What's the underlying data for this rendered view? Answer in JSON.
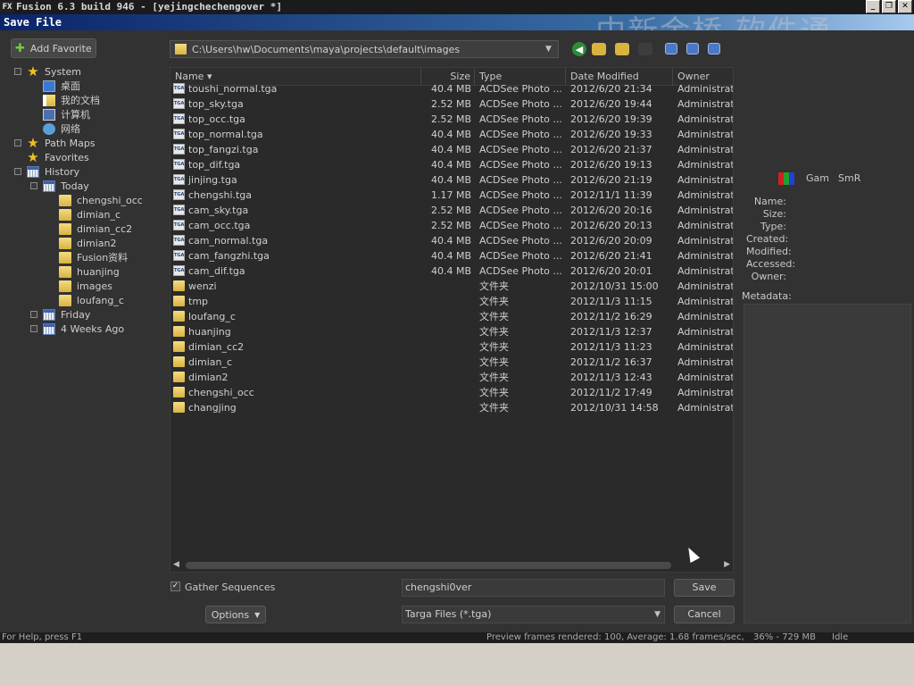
{
  "app": {
    "title": "Fusion 6.3 build 946 - [yejingchechengover *]",
    "logo": "FX",
    "window_buttons": [
      "_",
      "❐",
      "✕"
    ]
  },
  "watermark": "中新金桥 软件通",
  "dialog": {
    "title": "Save File"
  },
  "sidebar": {
    "add_favorite": "Add Favorite",
    "tree": [
      {
        "label": "System",
        "icon": "star-icon",
        "level": 0,
        "expander": true
      },
      {
        "label": "桌面",
        "icon": "desktop-icon",
        "level": 1,
        "expander": false
      },
      {
        "label": "我的文档",
        "icon": "my-documents-icon",
        "level": 1,
        "expander": false
      },
      {
        "label": "计算机",
        "icon": "computer-icon",
        "level": 1,
        "expander": false
      },
      {
        "label": "网络",
        "icon": "network-icon",
        "level": 1,
        "expander": false
      },
      {
        "label": "Path Maps",
        "icon": "star-icon",
        "level": 0,
        "expander": true
      },
      {
        "label": "Favorites",
        "icon": "star-icon",
        "level": 0,
        "expander": false
      },
      {
        "label": "History",
        "icon": "calendar-icon",
        "level": 0,
        "expander": true
      },
      {
        "label": "Today",
        "icon": "calendar-icon",
        "level": 1,
        "expander": true
      },
      {
        "label": "chengshi_occ",
        "icon": "folder-icon",
        "level": 2,
        "expander": false
      },
      {
        "label": "dimian_c",
        "icon": "folder-icon",
        "level": 2,
        "expander": false
      },
      {
        "label": "dimian_cc2",
        "icon": "folder-icon",
        "level": 2,
        "expander": false
      },
      {
        "label": "dimian2",
        "icon": "folder-icon",
        "level": 2,
        "expander": false
      },
      {
        "label": "Fusion资料",
        "icon": "folder-icon",
        "level": 2,
        "expander": false
      },
      {
        "label": "huanjing",
        "icon": "folder-icon",
        "level": 2,
        "expander": false
      },
      {
        "label": "images",
        "icon": "folder-icon",
        "level": 2,
        "expander": false
      },
      {
        "label": "loufang_c",
        "icon": "folder-icon",
        "level": 2,
        "expander": false
      },
      {
        "label": "Friday",
        "icon": "calendar-icon",
        "level": 1,
        "expander": true
      },
      {
        "label": "4 Weeks Ago",
        "icon": "calendar-icon",
        "level": 1,
        "expander": true
      }
    ]
  },
  "path": {
    "value": "C:\\Users\\hw\\Documents\\maya\\projects\\default\\images"
  },
  "list": {
    "columns": [
      "Name ▾",
      "Size",
      "Type",
      "Date Modified",
      "Owner"
    ],
    "rows": [
      {
        "name": "toushi_normal.tga",
        "size": "40.4 MB",
        "type": "ACDSee Photo ...",
        "date": "2012/6/20 21:34",
        "owner": "Administrator",
        "kind": "tga"
      },
      {
        "name": "top_sky.tga",
        "size": "2.52 MB",
        "type": "ACDSee Photo ...",
        "date": "2012/6/20 19:44",
        "owner": "Administrator",
        "kind": "tga"
      },
      {
        "name": "top_occ.tga",
        "size": "2.52 MB",
        "type": "ACDSee Photo ...",
        "date": "2012/6/20 19:39",
        "owner": "Administrator",
        "kind": "tga"
      },
      {
        "name": "top_normal.tga",
        "size": "40.4 MB",
        "type": "ACDSee Photo ...",
        "date": "2012/6/20 19:33",
        "owner": "Administrator",
        "kind": "tga"
      },
      {
        "name": "top_fangzi.tga",
        "size": "40.4 MB",
        "type": "ACDSee Photo ...",
        "date": "2012/6/20 21:37",
        "owner": "Administrator",
        "kind": "tga"
      },
      {
        "name": "top_dif.tga",
        "size": "40.4 MB",
        "type": "ACDSee Photo ...",
        "date": "2012/6/20 19:13",
        "owner": "Administrator",
        "kind": "tga"
      },
      {
        "name": "jinjing.tga",
        "size": "40.4 MB",
        "type": "ACDSee Photo ...",
        "date": "2012/6/20 21:19",
        "owner": "Administrator",
        "kind": "tga"
      },
      {
        "name": "chengshi.tga",
        "size": "1.17 MB",
        "type": "ACDSee Photo ...",
        "date": "2012/11/1 11:39",
        "owner": "Administrator",
        "kind": "tga"
      },
      {
        "name": "cam_sky.tga",
        "size": "2.52 MB",
        "type": "ACDSee Photo ...",
        "date": "2012/6/20 20:16",
        "owner": "Administrator",
        "kind": "tga"
      },
      {
        "name": "cam_occ.tga",
        "size": "2.52 MB",
        "type": "ACDSee Photo ...",
        "date": "2012/6/20 20:13",
        "owner": "Administrator",
        "kind": "tga"
      },
      {
        "name": "cam_normal.tga",
        "size": "40.4 MB",
        "type": "ACDSee Photo ...",
        "date": "2012/6/20 20:09",
        "owner": "Administrator",
        "kind": "tga"
      },
      {
        "name": "cam_fangzhi.tga",
        "size": "40.4 MB",
        "type": "ACDSee Photo ...",
        "date": "2012/6/20 21:41",
        "owner": "Administrator",
        "kind": "tga"
      },
      {
        "name": "cam_dif.tga",
        "size": "40.4 MB",
        "type": "ACDSee Photo ...",
        "date": "2012/6/20 20:01",
        "owner": "Administrator",
        "kind": "tga"
      },
      {
        "name": "wenzi",
        "size": "",
        "type": "文件夹",
        "date": "2012/10/31 15:00",
        "owner": "Administrator",
        "kind": "folder"
      },
      {
        "name": "tmp",
        "size": "",
        "type": "文件夹",
        "date": "2012/11/3 11:15",
        "owner": "Administrator",
        "kind": "folder"
      },
      {
        "name": "loufang_c",
        "size": "",
        "type": "文件夹",
        "date": "2012/11/2 16:29",
        "owner": "Administrator",
        "kind": "folder"
      },
      {
        "name": "huanjing",
        "size": "",
        "type": "文件夹",
        "date": "2012/11/3 12:37",
        "owner": "Administrator",
        "kind": "folder"
      },
      {
        "name": "dimian_cc2",
        "size": "",
        "type": "文件夹",
        "date": "2012/11/3 11:23",
        "owner": "Administrator",
        "kind": "folder"
      },
      {
        "name": "dimian_c",
        "size": "",
        "type": "文件夹",
        "date": "2012/11/2 16:37",
        "owner": "Administrator",
        "kind": "folder"
      },
      {
        "name": "dimian2",
        "size": "",
        "type": "文件夹",
        "date": "2012/11/3 12:43",
        "owner": "Administrator",
        "kind": "folder"
      },
      {
        "name": "chengshi_occ",
        "size": "",
        "type": "文件夹",
        "date": "2012/11/2 17:49",
        "owner": "Administrator",
        "kind": "folder"
      },
      {
        "name": "changjing",
        "size": "",
        "type": "文件夹",
        "date": "2012/10/31 14:58",
        "owner": "Administrator",
        "kind": "folder"
      }
    ]
  },
  "preview": {
    "gam": "Gam",
    "smr": "SmR",
    "info_labels": [
      "Name:",
      "Size:",
      "Type:",
      "Created:",
      "Modified:",
      "Accessed:",
      "Owner:"
    ],
    "metadata_label": "Metadata:"
  },
  "footer": {
    "gather_label": "Gather Sequences",
    "gather_checked": "✓",
    "options_label": "Options",
    "filename_value": "chengshi0ver",
    "filetype_value": "Targa Files (*.tga)",
    "save_label": "Save",
    "cancel_label": "Cancel"
  },
  "status": {
    "help": "For Help, press F1",
    "frames": "Preview frames rendered: 100,  Average: 1.68 frames/sec,",
    "memory": "36% - 729 MB",
    "state": "Idle"
  }
}
